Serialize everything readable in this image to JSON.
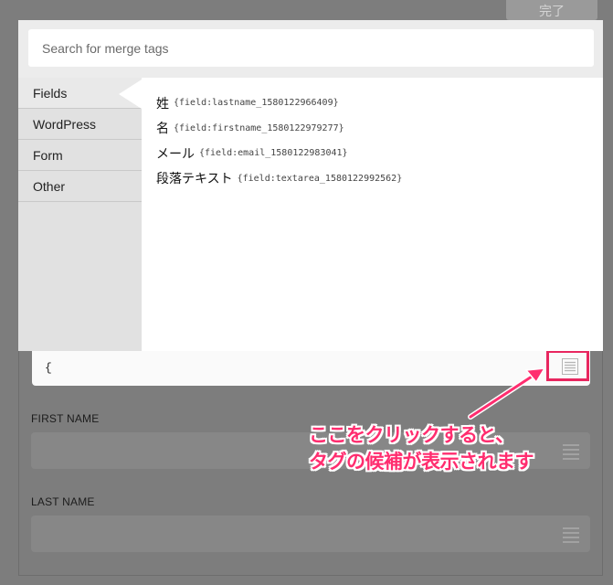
{
  "toolbar": {
    "done_label": "完了"
  },
  "search": {
    "placeholder": "Search for merge tags"
  },
  "sidebar": {
    "items": [
      {
        "label": "Fields",
        "active": true
      },
      {
        "label": "WordPress",
        "active": false
      },
      {
        "label": "Form",
        "active": false
      },
      {
        "label": "Other",
        "active": false
      }
    ]
  },
  "merge_tags": [
    {
      "name": "姓",
      "code": "{field:lastname_1580122966409}"
    },
    {
      "name": "名",
      "code": "{field:firstname_1580122979277}"
    },
    {
      "name": "メール",
      "code": "{field:email_1580122983041}"
    },
    {
      "name": "段落テキスト",
      "code": "{field:textarea_1580122992562}"
    }
  ],
  "value_input": {
    "value": "{"
  },
  "form_fields": [
    {
      "label": "FIRST NAME"
    },
    {
      "label": "LAST NAME"
    }
  ],
  "annotation": {
    "line1": "ここをクリックすると、",
    "line2": "タグの候補が表示されます",
    "color": "#ff2d6f",
    "box_color": "#e8265f"
  },
  "icons": {
    "merge_tag": "list-icon"
  }
}
